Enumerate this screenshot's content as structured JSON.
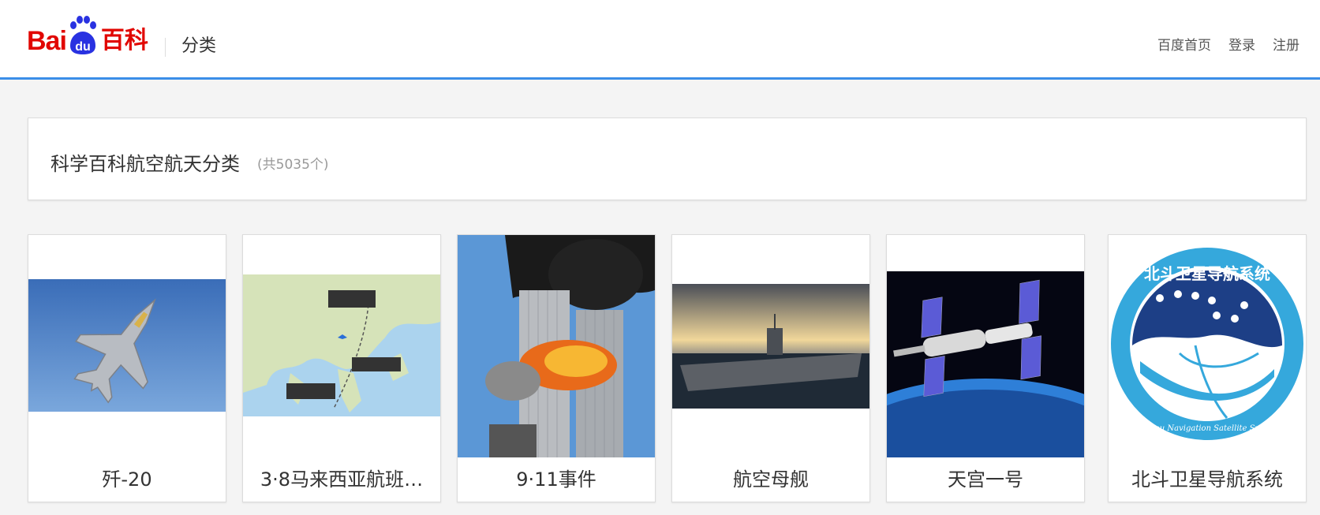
{
  "header": {
    "logo_text_latin": "Bai",
    "logo_text_du": "du",
    "logo_text_cn": "百科",
    "section_title": "分类",
    "nav": [
      "百度首页",
      "登录",
      "注册"
    ]
  },
  "category": {
    "title": "科学百科航空航天分类",
    "count": "(共5035个)"
  },
  "cards": [
    {
      "caption": "歼-20",
      "image": "fighter-jet-image"
    },
    {
      "caption": "3·8马来西亚航班…",
      "image": "flight-route-map-image"
    },
    {
      "caption": "9·11事件",
      "image": "twin-towers-attack-image"
    },
    {
      "caption": "航空母舰",
      "image": "aircraft-carrier-image"
    },
    {
      "caption": "天宫一号",
      "image": "space-station-image"
    },
    {
      "caption": "北斗卫星导航系统",
      "image": "beidou-logo-image"
    }
  ],
  "beidou_logo": {
    "cn_text": "北斗卫星导航系统",
    "en_text": "BeiDou Navigation Satellite System"
  },
  "colors": {
    "brand_red": "#e10601",
    "brand_blue": "#2932e1",
    "accent_blue": "#3b8ee8"
  }
}
